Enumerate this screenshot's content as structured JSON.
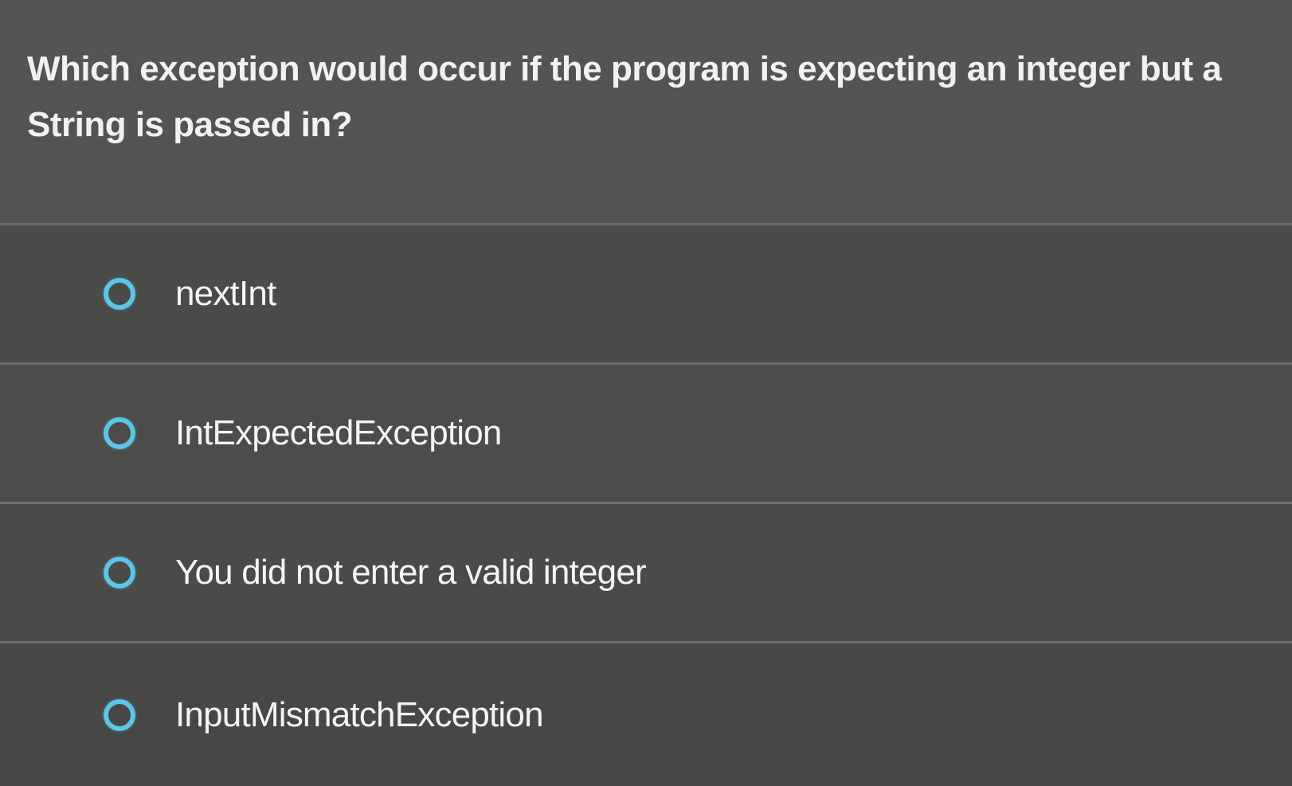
{
  "question": {
    "text": "Which exception would occur if the program is expecting an integer but a String is passed in?"
  },
  "options": [
    {
      "label": "nextInt"
    },
    {
      "label": "IntExpectedException"
    },
    {
      "label": "You did not enter a valid integer"
    },
    {
      "label": "InputMismatchException"
    }
  ],
  "colors": {
    "background": "#4a4a48",
    "radio_accent": "#5cc6e8",
    "divider": "#6c6c69",
    "text": "#f1f1ef"
  }
}
